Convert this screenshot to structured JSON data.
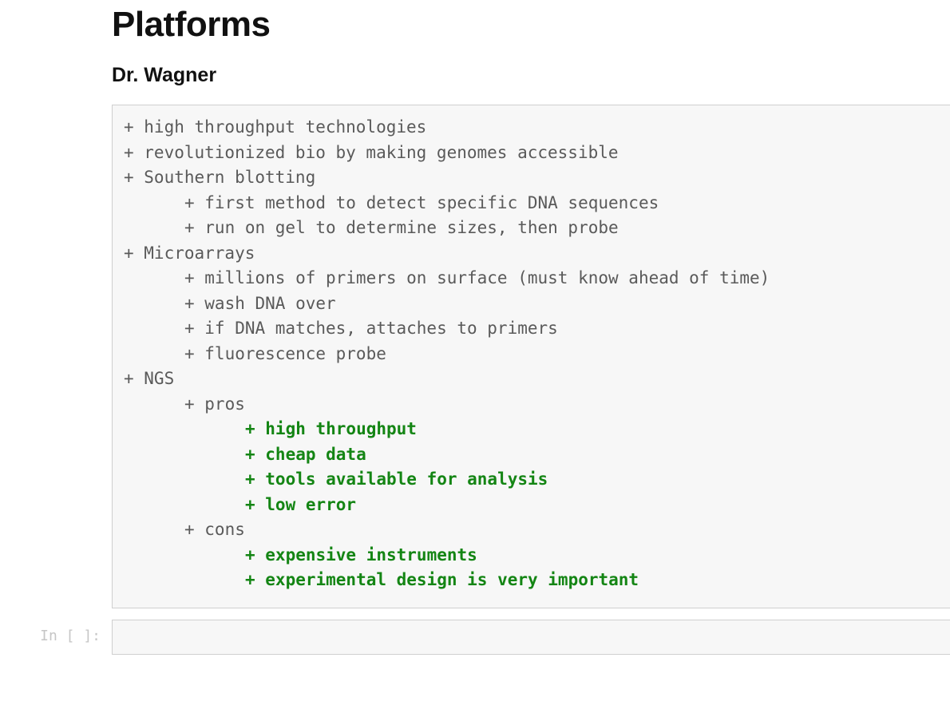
{
  "heading": "Platforms",
  "subheading": "Dr. Wagner",
  "code_lines": [
    {
      "text": "+ high throughput technologies",
      "indent": 0,
      "style": "plain"
    },
    {
      "text": "+ revolutionized bio by making genomes accessible",
      "indent": 0,
      "style": "plain"
    },
    {
      "text": "+ Southern blotting",
      "indent": 0,
      "style": "plain"
    },
    {
      "text": "+ first method to detect specific DNA sequences",
      "indent": 1,
      "style": "plain"
    },
    {
      "text": "+ run on gel to determine sizes, then probe",
      "indent": 1,
      "style": "plain"
    },
    {
      "text": "+ Microarrays",
      "indent": 0,
      "style": "plain"
    },
    {
      "text": "+ millions of primers on surface (must know ahead of time)",
      "indent": 1,
      "style": "plain"
    },
    {
      "text": "+ wash DNA over",
      "indent": 1,
      "style": "plain"
    },
    {
      "text": "+ if DNA matches, attaches to primers",
      "indent": 1,
      "style": "plain"
    },
    {
      "text": "+ fluorescence probe",
      "indent": 1,
      "style": "plain"
    },
    {
      "text": "+ NGS",
      "indent": 0,
      "style": "plain"
    },
    {
      "text": "+ pros",
      "indent": 1,
      "style": "plain"
    },
    {
      "text": "+ high throughput",
      "indent": 2,
      "style": "green"
    },
    {
      "text": "+ cheap data",
      "indent": 2,
      "style": "green"
    },
    {
      "text": "+ tools available for analysis",
      "indent": 2,
      "style": "green"
    },
    {
      "text": "+ low error",
      "indent": 2,
      "style": "green"
    },
    {
      "text": "+ cons",
      "indent": 1,
      "style": "plain"
    },
    {
      "text": "+ expensive instruments",
      "indent": 2,
      "style": "green"
    },
    {
      "text": "+ experimental design is very important",
      "indent": 2,
      "style": "green"
    }
  ],
  "next_prompt": "In [ ]:",
  "next_value": ""
}
